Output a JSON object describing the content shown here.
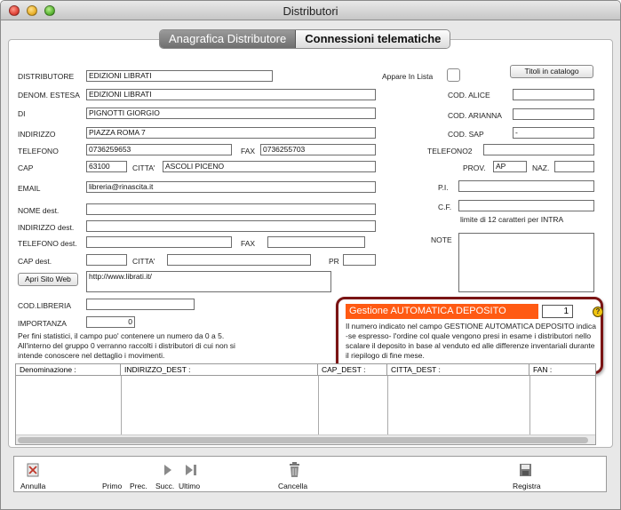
{
  "window": {
    "title": "Distributori"
  },
  "tabs": [
    {
      "label": "Anagrafica Distributore"
    },
    {
      "label": "Connessioni telematiche"
    }
  ],
  "fields": {
    "distributore": {
      "label": "DISTRIBUTORE",
      "value": "EDIZIONI LIBRATI"
    },
    "denom_estesa": {
      "label": "DENOM. ESTESA",
      "value": "EDIZIONI LIBRATI"
    },
    "di": {
      "label": "DI",
      "value": "PIGNOTTI GIORGIO"
    },
    "indirizzo": {
      "label": "INDIRIZZO",
      "value": "PIAZZA ROMA 7"
    },
    "telefono": {
      "label": "TELEFONO",
      "value": "0736259653"
    },
    "fax": {
      "label": "FAX",
      "value": "0736255703"
    },
    "cap": {
      "label": "CAP",
      "value": "63100"
    },
    "citta": {
      "label": "CITTA'",
      "value": "ASCOLI PICENO"
    },
    "email": {
      "label": "EMAIL",
      "value": "libreria@rinascita.it"
    },
    "nome_dest": {
      "label": "NOME dest.",
      "value": ""
    },
    "indirizzo_dest": {
      "label": "INDIRIZZO dest.",
      "value": ""
    },
    "telefono_dest": {
      "label": "TELEFONO dest.",
      "value": ""
    },
    "fax_dest": {
      "label": "FAX",
      "value": ""
    },
    "cap_dest": {
      "label": "CAP dest.",
      "value": ""
    },
    "citta_dest": {
      "label": "CITTA'",
      "value": ""
    },
    "pr_dest": {
      "label": "PR",
      "value": ""
    },
    "sito_web": {
      "value": "http://www.librati.it/"
    },
    "cod_libreria": {
      "label": "COD.LIBRERIA",
      "value": ""
    },
    "importanza": {
      "label": "IMPORTANZA",
      "value": "0"
    },
    "cod_alice": {
      "label": "COD. ALICE",
      "value": ""
    },
    "cod_arianna": {
      "label": "COD. ARIANNA",
      "value": ""
    },
    "cod_sap": {
      "label": "COD. SAP",
      "value": "-"
    },
    "telefono2": {
      "label": "TELEFONO2",
      "value": ""
    },
    "prov": {
      "label": "PROV.",
      "value": "AP"
    },
    "naz": {
      "label": "NAZ.",
      "value": ""
    },
    "pi": {
      "label": "P.I.",
      "value": ""
    },
    "cf": {
      "label": "C.F.",
      "value": ""
    },
    "note": {
      "label": "NOTE",
      "value": ""
    }
  },
  "appare_in_lista": {
    "label": "Appare In Lista",
    "checked": false
  },
  "buttons": {
    "titoli": "Titoli in catalogo",
    "apri_sito": "Apri Sito Web"
  },
  "cf_hint": "limite di 12 caratteri per INTRA",
  "importanza_note": "Per fini statistici, il campo puo' contenere un numero da 0 a 5. All'interno del gruppo 0 verranno raccolti i distributori di cui non si intende conoscere nel dettaglio i movimenti.",
  "gestione": {
    "title": "Gestione AUTOMATICA DEPOSITO",
    "value": "1",
    "help": "?",
    "description": "Il numero indicato nel campo GESTIONE AUTOMATICA DEPOSITO indica -se espresso- l'ordine col quale vengono presi in esame i distributori nello scalare il deposito in base al venduto ed alle differenze inventariali durante il riepilogo di fine mese.",
    "accent": "#ff5a13",
    "border": "#7a1414"
  },
  "table": {
    "columns": [
      "Denominazione :",
      "INDIRIZZO_DEST :",
      "CAP_DEST :",
      "CITTA_DEST :",
      "FAN :"
    ]
  },
  "toolbar": {
    "annulla": "Annulla",
    "primo": "Primo",
    "prec": "Prec.",
    "succ": "Succ.",
    "ultimo": "Ultimo",
    "cancella": "Cancella",
    "registra": "Registra"
  }
}
